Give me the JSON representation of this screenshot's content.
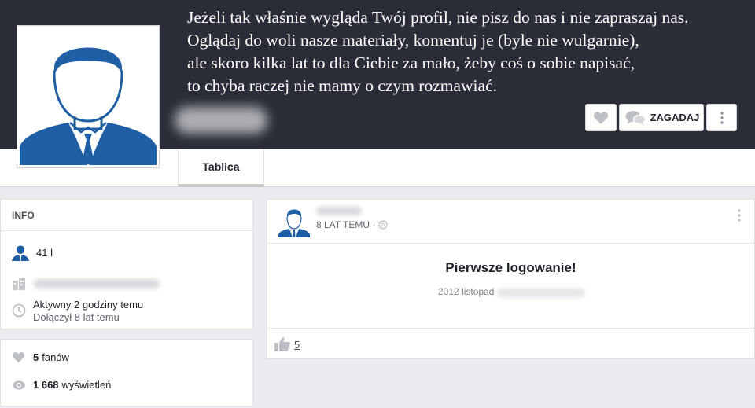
{
  "header": {
    "bio_lines": [
      "Jeżeli tak właśnie wygląda Twój profil, nie pisz do nas i nie zapraszaj nas.",
      "Oglądaj do woli nasze materiały, komentuj je (byle nie wulgarnie),",
      "ale skoro kilka lat to dla Ciebie za mało, żeby coś o sobie napisać,",
      "to chyba raczej nie mamy o czym rozmawiać."
    ],
    "ask_label": "ZAGADAJ"
  },
  "tabs": [
    {
      "label": "Tablica"
    }
  ],
  "info": {
    "heading": "INFO",
    "age": "41 l",
    "active": "Aktywny 2 godziny temu",
    "joined": "Dołączył 8 lat temu"
  },
  "stats": {
    "fans_count": "5",
    "fans_label": "fanów",
    "views_count": "1 668",
    "views_label": "wyświetleń"
  },
  "post": {
    "time": "8 LAT TEMU ·",
    "title": "Pierwsze logowanie!",
    "date": "2012 listopad",
    "likes": "5"
  },
  "colors": {
    "header_bg": "#2a2d38",
    "avatar_blue": "#1f5fa6",
    "page_bg": "#e9ebee"
  }
}
